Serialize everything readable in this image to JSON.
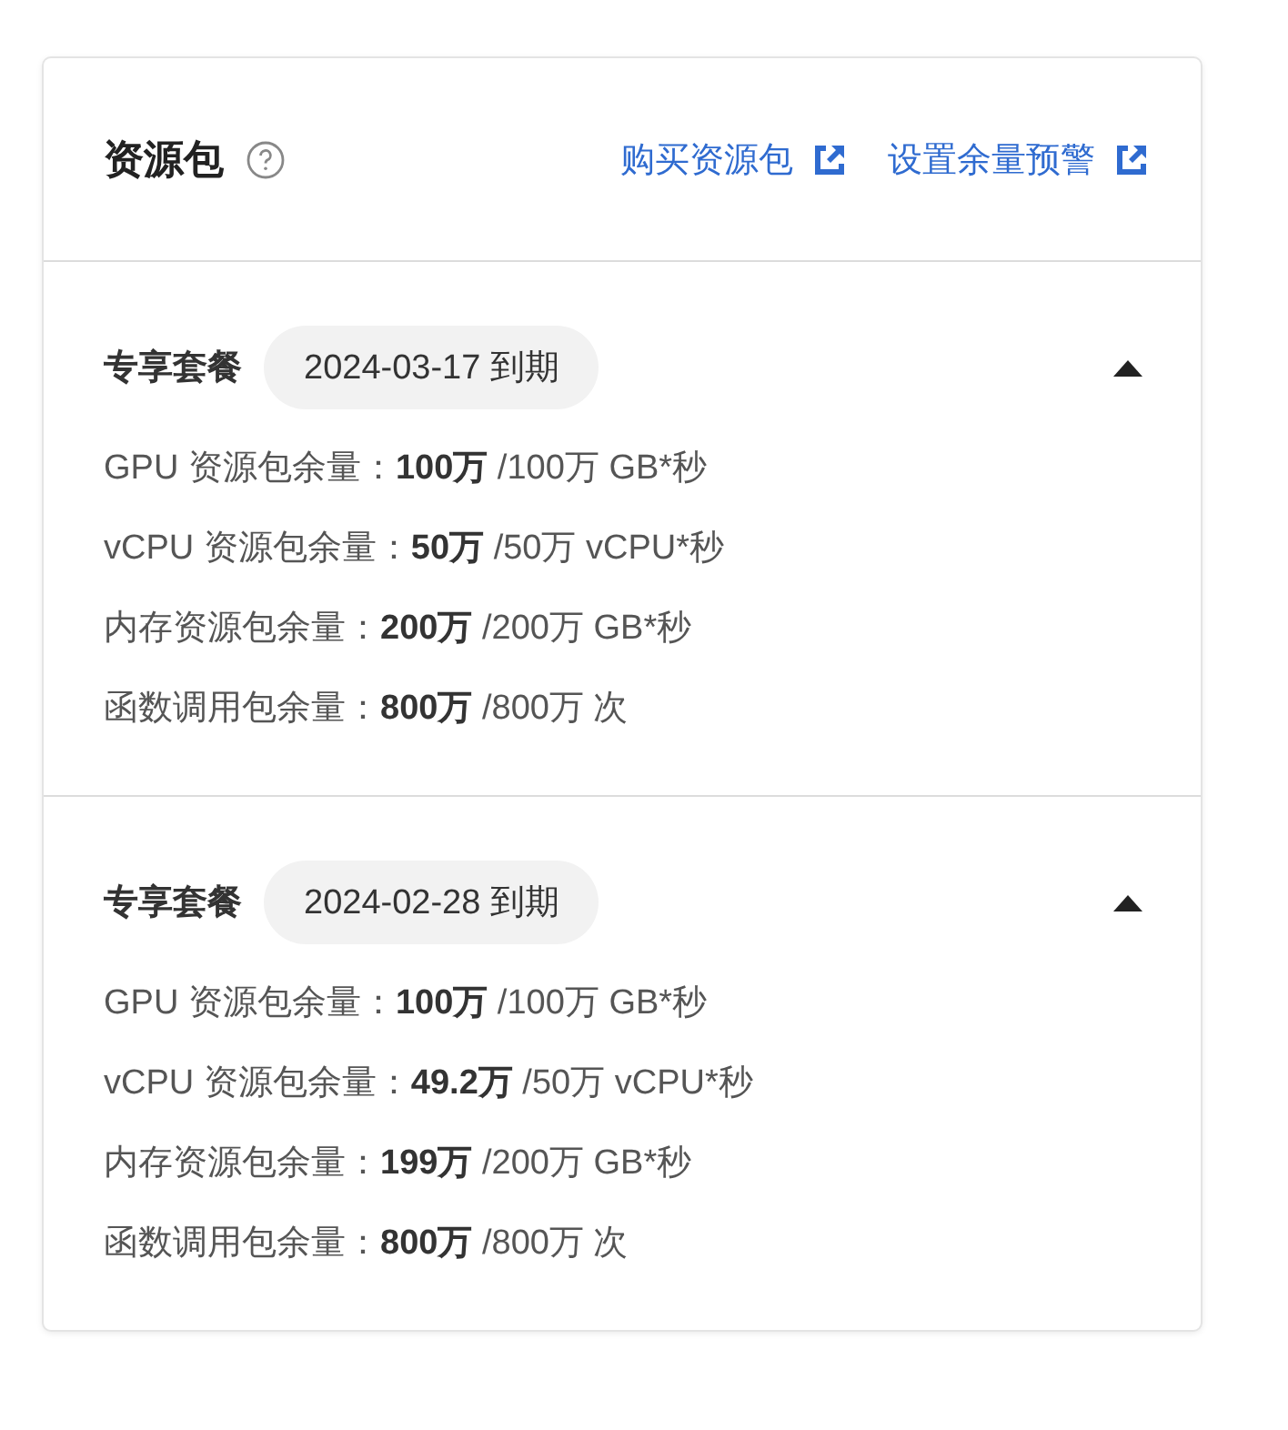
{
  "header": {
    "title": "资源包",
    "links": [
      "购买资源包",
      "设置余量预警"
    ]
  },
  "packages": [
    {
      "name": "专享套餐",
      "expiry": "2024-03-17 到期",
      "expanded": true,
      "lines": [
        "GPU 资源包余量：**100万** /100万 GB*秒",
        "vCPU 资源包余量：**50万** /50万 vCPU*秒",
        "内存资源包余量：**200万** /200万 GB*秒",
        "函数调用包余量：**800万** /800万 次"
      ]
    },
    {
      "name": "专享套餐",
      "expiry": "2024-02-28 到期",
      "expanded": true,
      "lines": [
        "GPU 资源包余量：**100万** /100万 GB*秒",
        "vCPU 资源包余量：**49.2万** /50万 vCPU*秒",
        "内存资源包余量：**199万** /200万 GB*秒",
        "函数调用包余量：**800万** /800万 次"
      ]
    }
  ]
}
